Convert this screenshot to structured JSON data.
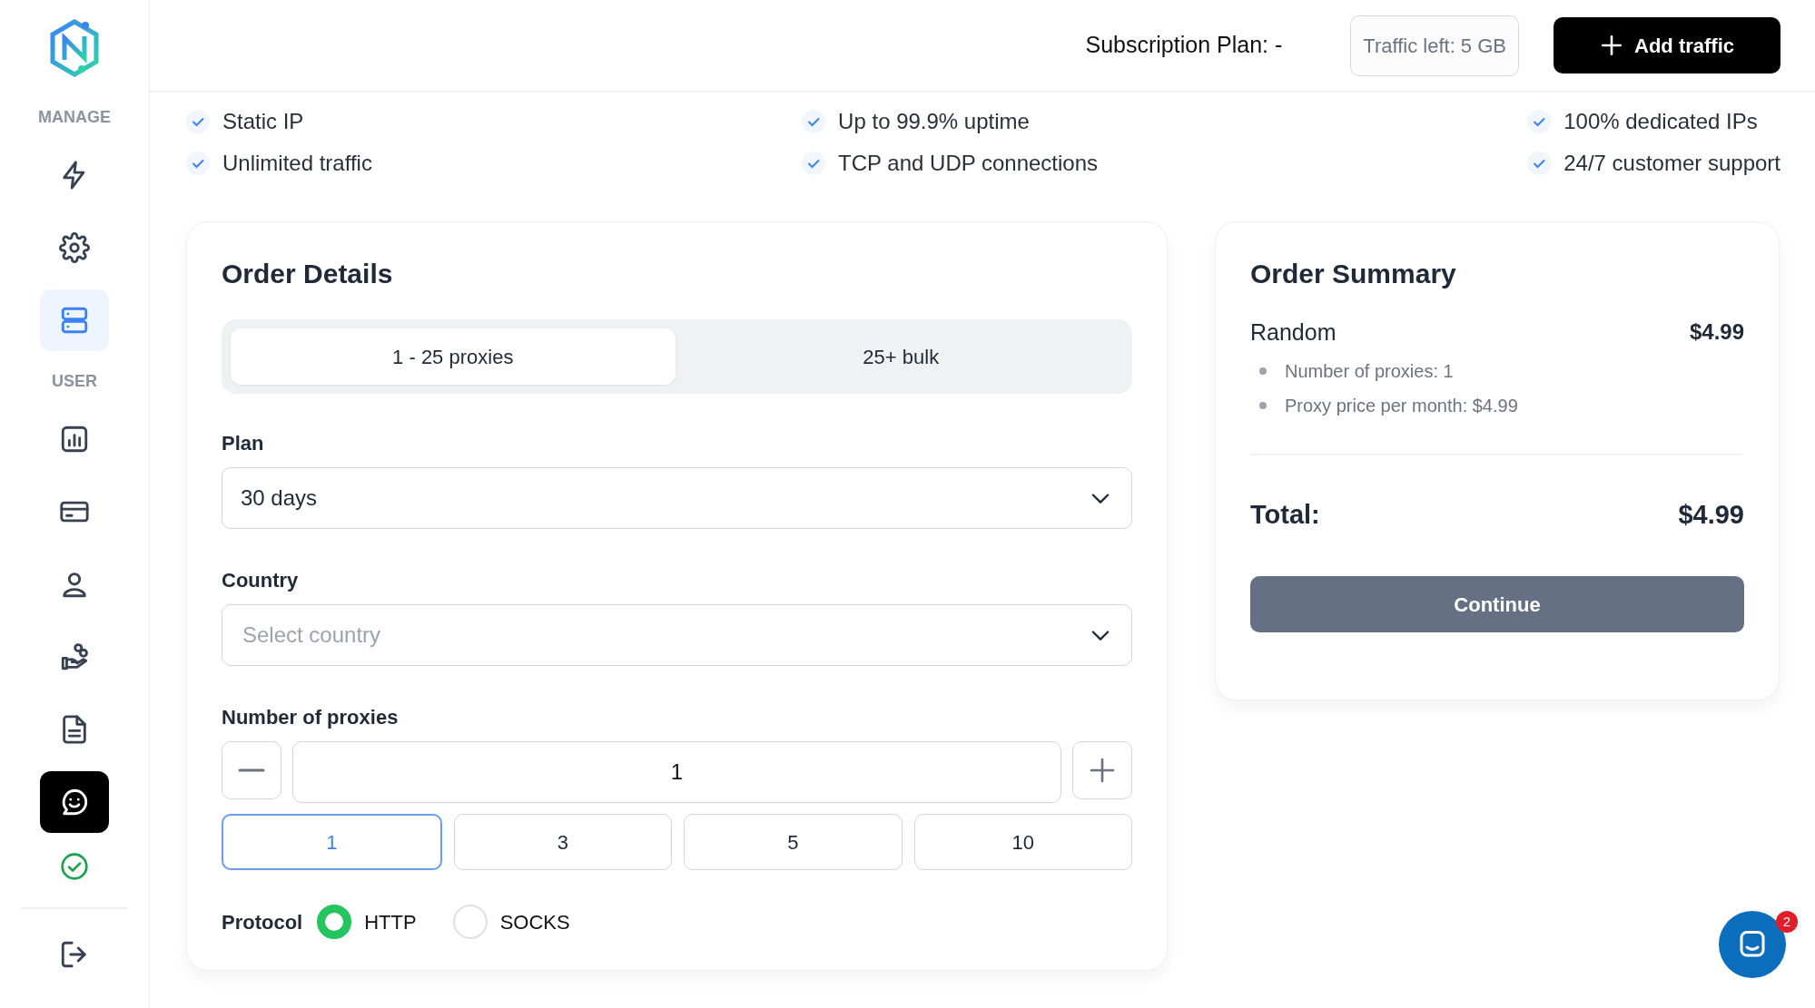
{
  "sidebar": {
    "sections": [
      {
        "label": "MANAGE",
        "items": [
          {
            "selected": false
          },
          {
            "selected": false
          },
          {
            "selected": true
          }
        ]
      },
      {
        "label": "USER",
        "items": [
          {
            "selected": false
          },
          {
            "selected": false
          },
          {
            "selected": false
          },
          {
            "selected": false
          },
          {
            "selected": false
          },
          {
            "selected": false,
            "kind": "dark"
          },
          {
            "selected": false,
            "kind": "status"
          }
        ]
      }
    ],
    "footer_items": [
      {
        "selected": false
      }
    ]
  },
  "header": {
    "subscription": "Subscription Plan: -",
    "traffic_left": "Traffic left: 5 GB",
    "add_button": "Add traffic"
  },
  "features": [
    [
      "Static IP",
      "Unlimited traffic"
    ],
    [
      "Up to 99.9% uptime",
      "TCP and UDP connections"
    ],
    [
      "100% dedicated IPs",
      "24/7 customer support"
    ]
  ],
  "order_details": {
    "title": "Order Details",
    "tabs": [
      {
        "label": "1 - 25 proxies",
        "selected": true
      },
      {
        "label": "25+ bulk",
        "selected": false
      }
    ],
    "plan": {
      "label": "Plan",
      "value": "30 days"
    },
    "country": {
      "label": "Country",
      "placeholder": "Select country"
    },
    "quantity": {
      "label": "Number of proxies",
      "value": "1"
    },
    "presets": [
      {
        "label": "1",
        "selected": true
      },
      {
        "label": "3",
        "selected": false
      },
      {
        "label": "5",
        "selected": false
      },
      {
        "label": "10",
        "selected": false
      }
    ],
    "protocol": {
      "label": "Protocol",
      "options": [
        {
          "label": "HTTP",
          "selected": true
        },
        {
          "label": "SOCKS",
          "selected": false
        }
      ]
    }
  },
  "order_summary": {
    "title": "Order Summary",
    "item": {
      "name": "Random",
      "price": "$4.99",
      "details": [
        "Number of proxies: 1",
        "Proxy price per month: $4.99"
      ]
    },
    "total_label": "Total:",
    "total": "$4.99",
    "button": "Continue"
  },
  "chat_widget": {
    "badge": "2"
  }
}
